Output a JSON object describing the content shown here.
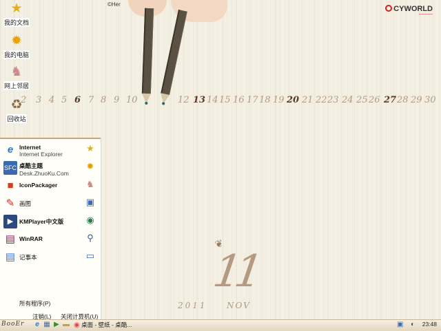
{
  "desktop": {
    "icons": [
      {
        "label": "我的文档",
        "icon": "star-icon",
        "glyph": "★",
        "color": "#e0b020"
      },
      {
        "label": "我的电脑",
        "icon": "sun-icon",
        "glyph": "✹",
        "color": "#e8a000"
      },
      {
        "label": "网上邻居",
        "icon": "bunny-icon",
        "glyph": "♞",
        "color": "#c88"
      },
      {
        "label": "回收站",
        "icon": "recycle-bin-icon",
        "glyph": "♻",
        "color": "#8a6b4a"
      }
    ],
    "credit": "©Her",
    "brand": {
      "name": "CYWORLD",
      "tagline": "~~~~~"
    }
  },
  "wallpaper": {
    "calendar_days": [
      "2",
      "3",
      "4",
      "5",
      "6",
      "7",
      "8",
      "9",
      "10",
      "12",
      "13",
      "14",
      "15",
      "16",
      "17",
      "18",
      "19",
      "20",
      "21",
      "22",
      "23",
      "24",
      "25",
      "26",
      "27",
      "28",
      "29",
      "30"
    ],
    "highlighted_days": [
      "6",
      "13",
      "20",
      "27"
    ],
    "month_number": "11",
    "year": "2011",
    "month_name": "NOV"
  },
  "start_menu": {
    "pinned": [
      {
        "title": "Internet",
        "subtitle": "Internet Explorer",
        "icon": "ie-icon",
        "glyph": "e",
        "color": "#1e7bd6"
      },
      {
        "title": "桌酷主题",
        "subtitle": "Desk.ZhuoKu.Com",
        "icon": "zhuoku-icon",
        "glyph": "▦",
        "color": "#3a6ab0"
      }
    ],
    "programs": [
      {
        "title": "IconPackager",
        "icon": "iconpackager-icon",
        "glyph": "■",
        "color": "#d04020"
      },
      {
        "title": "画图",
        "icon": "paint-icon",
        "glyph": "✎",
        "color": "#c83030"
      },
      {
        "title": "KMPlayer中文版",
        "icon": "kmplayer-icon",
        "glyph": "▶",
        "color": "#2a4a80"
      },
      {
        "title": "WinRAR",
        "icon": "winrar-icon",
        "glyph": "▤",
        "color": "#8a2060"
      },
      {
        "title": "记事本",
        "icon": "notepad-icon",
        "glyph": "▤",
        "color": "#3a7ad8"
      }
    ],
    "right_icons": [
      {
        "icon": "star-icon",
        "glyph": "★",
        "color": "#e0b020"
      },
      {
        "icon": "sun-icon",
        "glyph": "✹",
        "color": "#e8a000"
      },
      {
        "icon": "bunny-icon",
        "glyph": "♞",
        "color": "#c88"
      },
      {
        "icon": "control-panel-icon",
        "glyph": "▣",
        "color": "#3a6ab0"
      },
      {
        "icon": "network-globe-icon",
        "glyph": "◉",
        "color": "#2a7a4a"
      },
      {
        "icon": "search-icon",
        "glyph": "⚲",
        "color": "#3a5a90"
      },
      {
        "icon": "run-icon",
        "glyph": "▭",
        "color": "#3a6ab0"
      }
    ],
    "all_programs": "所有程序(P)",
    "logout": "注销(L)",
    "shutdown": "关闭计算机(U)"
  },
  "taskbar": {
    "start_label": "BooEr",
    "quick_launch": [
      {
        "icon": "ie-quicklaunch-icon",
        "glyph": "e",
        "color": "#1e7bd6"
      },
      {
        "icon": "show-desktop-icon",
        "glyph": "▦",
        "color": "#4a6aa0"
      },
      {
        "icon": "media-player-icon",
        "glyph": "▶",
        "color": "#3a8a3a"
      },
      {
        "icon": "folder-icon",
        "glyph": "▬",
        "color": "#c8a040"
      }
    ],
    "task": {
      "label": "桌面 - 壁纸 - 桌酷...",
      "icon": "chrome-icon"
    },
    "clock": "23:48"
  }
}
